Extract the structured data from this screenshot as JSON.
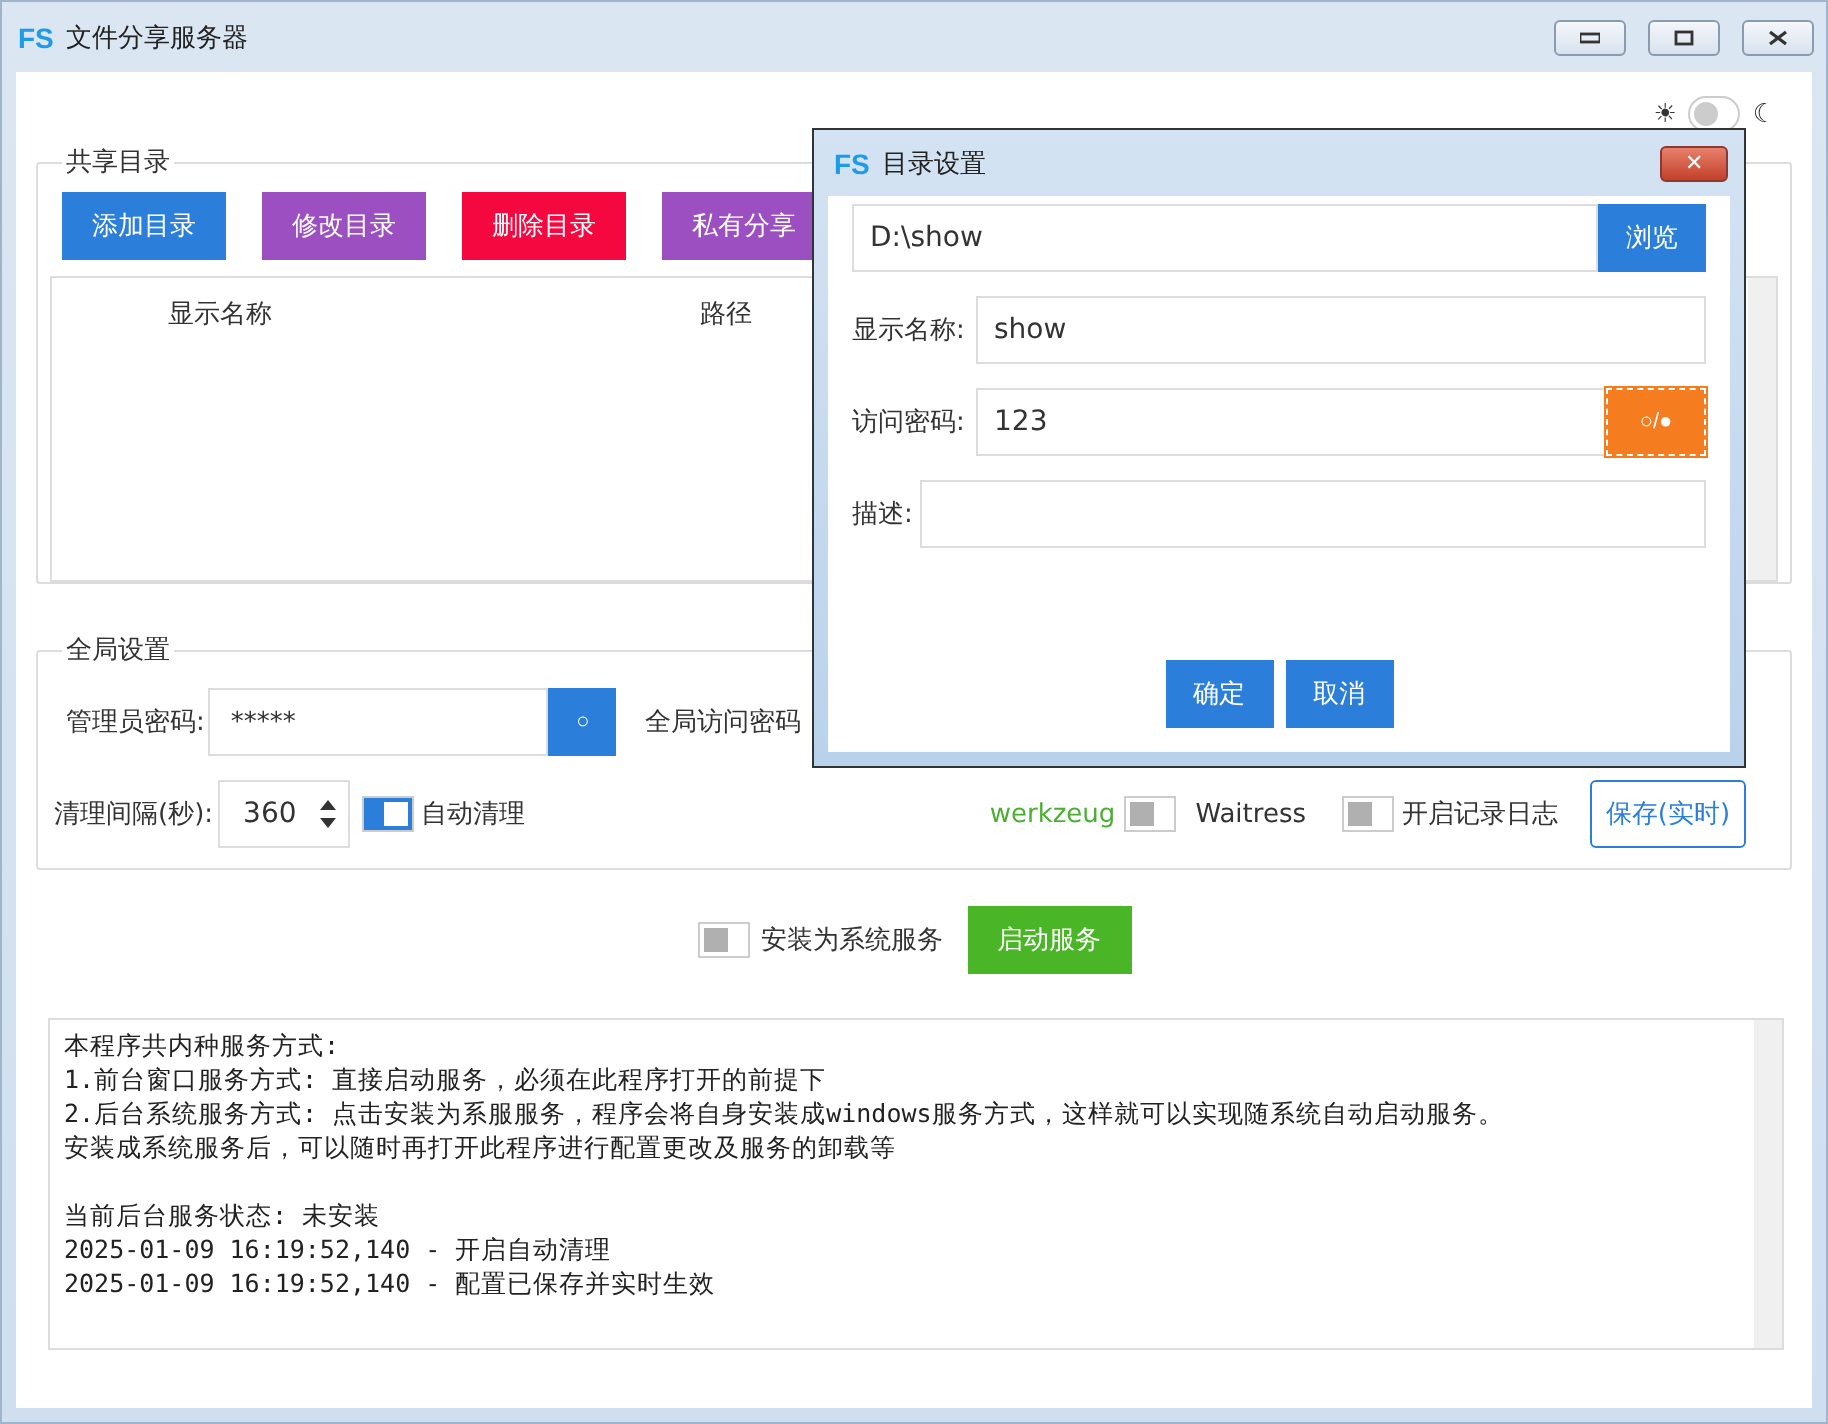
{
  "window": {
    "logo": "FS",
    "title": "文件分享服务器"
  },
  "theme_toggle": {
    "on": false,
    "sun": "☀",
    "moon": "☾"
  },
  "shared_dirs": {
    "legend": "共享目录",
    "buttons": [
      {
        "label": "添加目录",
        "color": "#2b7fdb"
      },
      {
        "label": "修改目录",
        "color": "#9b4fc0"
      },
      {
        "label": "删除目录",
        "color": "#f5083f"
      },
      {
        "label": "私有分享",
        "color": "#9b4fc0"
      }
    ],
    "table": {
      "columns": [
        "显示名称",
        "路径"
      ]
    }
  },
  "global_settings": {
    "legend": "全局设置",
    "admin_password": {
      "label": "管理员密码:",
      "value": "*****",
      "toggle": "○"
    },
    "global_password": {
      "label": "全局访问密码"
    },
    "cleanup_interval": {
      "label": "清理间隔(秒):",
      "value": "360"
    },
    "auto_clean": {
      "label": "自动清理",
      "on": true
    },
    "server_options": [
      {
        "label": "werkzeug",
        "selected": true
      },
      {
        "label": "Waitress",
        "selected": false
      }
    ],
    "logging": {
      "label": "开启记录日志",
      "on": false
    },
    "save_button": "保存(实时)"
  },
  "service": {
    "install": {
      "label": "安装为系统服务",
      "on": false
    },
    "start_button": "启动服务"
  },
  "log": [
    [
      "本程序共内种服务方式:",
      "1.前台窗口服务方式: 直接启动服务，必须在此程序打开的前提下",
      "2.后台系统服务方式: 点击安装为系服服务，程序会将自身安装成windows服务方式，这样就可以实现随系统自动启动服务。",
      "安装成系统服务后，可以随时再打开此程序进行配置更改及服务的卸载等"
    ],
    [
      "当前后台服务状态: 未安装",
      "2025-01-09 16:19:52,140 - 开启自动清理",
      "2025-01-09 16:19:52,140 - 配置已保存并实时生效"
    ]
  ],
  "dialog": {
    "logo": "FS",
    "title": "目录设置",
    "close": "✕",
    "path": {
      "value": "D:\\show",
      "button": "浏览"
    },
    "display_name": {
      "label": "显示名称:",
      "value": "show"
    },
    "access_password": {
      "label": "访问密码:",
      "value": "123",
      "toggle": "○/●"
    },
    "description": {
      "label": "描述:"
    },
    "buttons": [
      "确定",
      "取消"
    ]
  }
}
